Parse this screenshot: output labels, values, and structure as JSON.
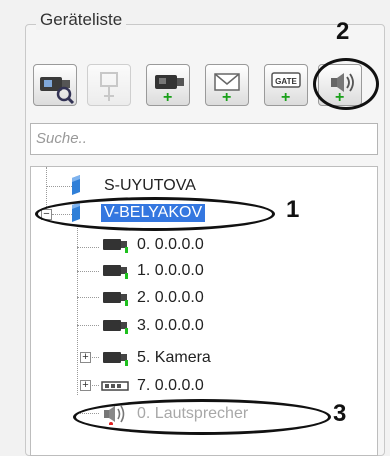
{
  "panel": {
    "title": "Geräteliste"
  },
  "toolbar": {
    "buttons": [
      {
        "name": "camera-view-icon",
        "enabled": true
      },
      {
        "name": "add-generic-device-icon",
        "enabled": false
      },
      {
        "name": "add-camera-icon",
        "enabled": true
      },
      {
        "name": "add-message-icon",
        "enabled": true
      },
      {
        "name": "add-gate-icon",
        "enabled": true,
        "text": "GATE"
      },
      {
        "name": "add-speaker-icon",
        "enabled": true
      }
    ],
    "plus_sign": "+"
  },
  "search": {
    "placeholder": "Suche.."
  },
  "tree": {
    "nodes": [
      {
        "label": "S-UYUTOVA",
        "icon": "server-icon"
      },
      {
        "label": "V-BELYAKOV",
        "icon": "server-icon",
        "selected": true,
        "expanded": true,
        "expander": "−"
      },
      {
        "label": "0. 0.0.0.0",
        "icon": "camera-icon"
      },
      {
        "label": "1. 0.0.0.0",
        "icon": "camera-icon"
      },
      {
        "label": "2. 0.0.0.0",
        "icon": "camera-icon"
      },
      {
        "label": "3. 0.0.0.0",
        "icon": "camera-icon"
      },
      {
        "label": "5. Kamera",
        "icon": "camera-icon",
        "expander": "+"
      },
      {
        "label": "7. 0.0.0.0",
        "icon": "board-icon",
        "expander": "+"
      },
      {
        "label": "0. Lautsprecher",
        "icon": "speaker-icon",
        "disabled": true
      }
    ]
  },
  "callouts": [
    "1",
    "2",
    "3"
  ],
  "colors": {
    "selection": "#3477e0",
    "plus": "#1aa01a",
    "status_green": "#1ec01e",
    "status_red": "#e02020"
  }
}
